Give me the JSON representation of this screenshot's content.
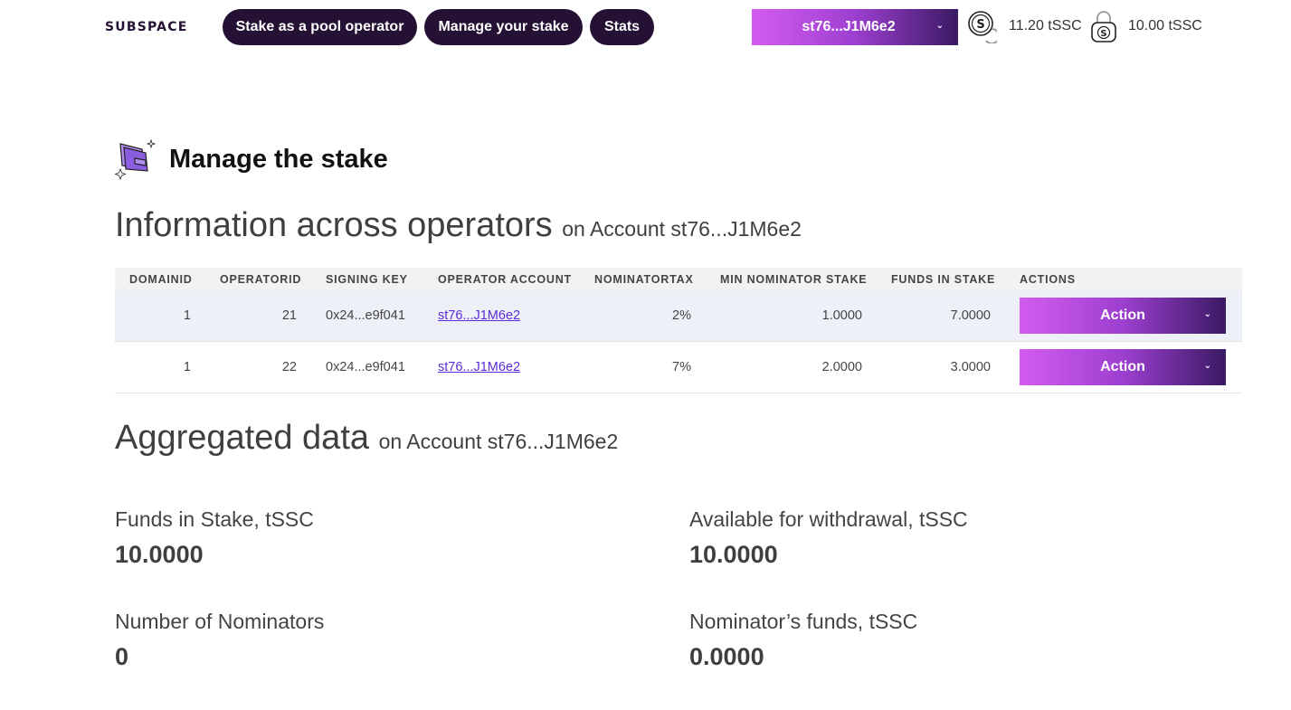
{
  "header": {
    "logo": "SUBSPACE",
    "nav": {
      "stake_pool": "Stake as a pool operator",
      "manage": "Manage your stake",
      "stats": "Stats"
    },
    "account": "st76...J1M6e2",
    "balances": [
      {
        "value": "11.20 tSSC",
        "icon": "coin-icon"
      },
      {
        "value": "10.00 tSSC",
        "icon": "locked-coin-icon"
      }
    ]
  },
  "page": {
    "title": "Manage the stake"
  },
  "info": {
    "title": "Information across operators",
    "subtitle": "on Account st76...J1M6e2"
  },
  "table": {
    "columns": [
      "DOMAINID",
      "OPERATORID",
      "SIGNING KEY",
      "OPERATOR ACCOUNT",
      "NOMINATORTAX",
      "MIN NOMINATOR STAKE",
      "FUNDS IN STAKE",
      "ACTIONS"
    ],
    "rows": [
      {
        "domain_id": "1",
        "operator_id": "21",
        "signing_key": "0x24...e9f041",
        "operator_account": "st76...J1M6e2",
        "nominator_tax": "2%",
        "min_nominator_stake": "1.0000",
        "funds_in_stake": "7.0000",
        "action": "Action"
      },
      {
        "domain_id": "1",
        "operator_id": "22",
        "signing_key": "0x24...e9f041",
        "operator_account": "st76...J1M6e2",
        "nominator_tax": "7%",
        "min_nominator_stake": "2.0000",
        "funds_in_stake": "3.0000",
        "action": "Action"
      }
    ]
  },
  "aggregated": {
    "title": "Aggregated data",
    "subtitle": "on Account st76...J1M6e2",
    "stats": {
      "funds_in_stake": {
        "label": "Funds in Stake, tSSC",
        "value": "10.0000"
      },
      "available_withdrawal": {
        "label": "Available for withdrawal, tSSC",
        "value": "10.0000"
      },
      "num_nominators": {
        "label": "Number of Nominators",
        "value": "0"
      },
      "nominators_funds": {
        "label": "Nominator’s funds, tSSC",
        "value": "0.0000"
      }
    }
  },
  "colors": {
    "nav_bg": "#241133",
    "gradient_start": "#d35cf0",
    "gradient_end": "#3a1a63",
    "link": "#5a2bd8",
    "row_highlight": "#edf1f7"
  }
}
